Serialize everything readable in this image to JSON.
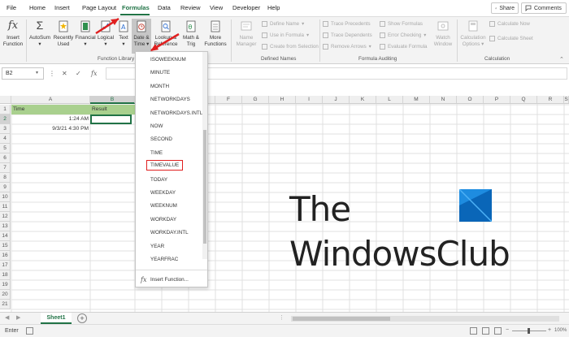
{
  "menu": {
    "tabs": [
      "File",
      "Home",
      "Insert",
      "Page Layout",
      "Formulas",
      "Data",
      "Review",
      "View",
      "Developer",
      "Help"
    ],
    "active_tab": "Formulas",
    "share_label": "Share",
    "comments_label": "Comments"
  },
  "ribbon": {
    "insert_function": [
      "Insert",
      "Function"
    ],
    "autosum": "AutoSum",
    "recently_used": [
      "Recently",
      "Used"
    ],
    "financial": "Financial",
    "logical": "Logical",
    "text": "Text",
    "date_time": [
      "Date &",
      "Time"
    ],
    "lookup_reference": [
      "Lookup &",
      "Reference"
    ],
    "math_trig": [
      "Math &",
      "Trig"
    ],
    "more_functions": [
      "More",
      "Functions"
    ],
    "name_manager": [
      "Name",
      "Manager"
    ],
    "define_name": "Define Name",
    "use_in_formula": "Use in Formula",
    "create_from_selection": "Create from Selection",
    "trace_precedents": "Trace Precedents",
    "trace_dependents": "Trace Dependents",
    "remove_arrows": "Remove Arrows",
    "show_formulas": "Show Formulas",
    "error_checking": "Error Checking",
    "evaluate_formula": "Evaluate Formula",
    "watch_window": [
      "Watch",
      "Window"
    ],
    "calculation_options": [
      "Calculation",
      "Options"
    ],
    "calculate_now": "Calculate Now",
    "calculate_sheet": "Calculate Sheet",
    "groups": {
      "function_library": "Function Library",
      "defined_names": "Defined Names",
      "formula_auditing": "Formula Auditing",
      "calculation": "Calculation"
    }
  },
  "formula_bar": {
    "name_box": "B2",
    "fx": "fx"
  },
  "grid": {
    "columns": [
      "A",
      "B",
      "C",
      "D",
      "E",
      "F",
      "G",
      "H",
      "I",
      "J",
      "K",
      "L",
      "M",
      "N",
      "O",
      "P",
      "Q",
      "R",
      "S"
    ],
    "rows": [
      "1",
      "2",
      "3",
      "4",
      "5",
      "6",
      "7",
      "8",
      "9",
      "10",
      "11",
      "12",
      "13",
      "14",
      "15",
      "16",
      "17",
      "18",
      "19",
      "20",
      "21"
    ],
    "cells": {
      "A1": "Time",
      "B1": "Result",
      "A2": "1:24 AM",
      "A3": "9/3/21 4:30 PM"
    },
    "selected_cell": "B2"
  },
  "dropdown": {
    "items": [
      "ISOWEEKNUM",
      "MINUTE",
      "MONTH",
      "NETWORKDAYS",
      "NETWORKDAYS.INTL",
      "NOW",
      "SECOND",
      "TIME",
      "TIMEVALUE",
      "TODAY",
      "WEEKDAY",
      "WEEKNUM",
      "WORKDAY",
      "WORKDAY.INTL",
      "YEAR",
      "YEARFRAC"
    ],
    "highlighted": "TIMEVALUE",
    "insert_function": "Insert Function..."
  },
  "logo": {
    "line1": "The",
    "line2": "WindowsClub"
  },
  "sheets": {
    "tabs": [
      "Sheet1"
    ],
    "add": "+"
  },
  "status": {
    "mode": "Enter",
    "zoom": "100%"
  },
  "colors": {
    "excel_green": "#217346",
    "header_fill": "#a9d08e",
    "annotation_red": "#e02020"
  }
}
